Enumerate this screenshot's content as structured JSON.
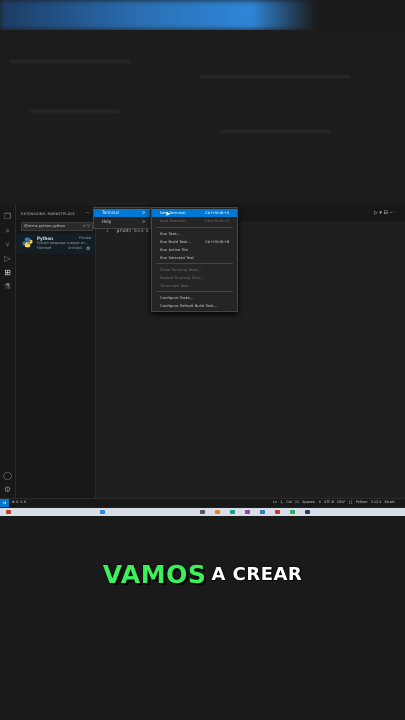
{
  "sidebar": {
    "title": "EXTENSIONS: MARKETPLACE",
    "search_value": "@id:ms-python.python",
    "extension": {
      "name": "Python",
      "description": "Python language support wi...",
      "publisher": "Microsoft",
      "badge": "Preview",
      "installs_label": "Uninstall"
    }
  },
  "editor": {
    "line_number": "1",
    "code_func": "print(",
    "code_str": "'hola m"
  },
  "menubar_menu": {
    "items": [
      {
        "label": "Terminal",
        "arrow": ">"
      },
      {
        "label": "Help",
        "arrow": ">"
      }
    ]
  },
  "terminal_menu": {
    "items": [
      {
        "label": "New Terminal",
        "shortcut": "Ctrl+Shift+ñ",
        "state": "highlighted"
      },
      {
        "label": "Split Terminal",
        "shortcut": "Ctrl+Shift+5",
        "state": "disabled"
      },
      {
        "label": "Run Task...",
        "shortcut": "",
        "state": "normal"
      },
      {
        "label": "Run Build Task...",
        "shortcut": "Ctrl+Shift+B",
        "state": "normal"
      },
      {
        "label": "Run Active File",
        "shortcut": "",
        "state": "normal"
      },
      {
        "label": "Run Selected Text",
        "shortcut": "",
        "state": "normal"
      },
      {
        "label": "Show Running Tasks...",
        "shortcut": "",
        "state": "disabled"
      },
      {
        "label": "Restart Running Task...",
        "shortcut": "",
        "state": "disabled"
      },
      {
        "label": "Terminate Task...",
        "shortcut": "",
        "state": "disabled"
      },
      {
        "label": "Configure Tasks...",
        "shortcut": "",
        "state": "normal"
      },
      {
        "label": "Configure Default Build Task...",
        "shortcut": "",
        "state": "normal"
      }
    ]
  },
  "status_bar": {
    "left": "⊗ 0 ⚠ 0",
    "right": "Ln 1, Col 21  Spaces: 4  UTF-8  CRLF  {} Python  3.12.4 64-bit"
  },
  "caption": {
    "highlight": "VAMOS",
    "rest": "A CREAR"
  },
  "colors": {
    "accent": "#0078d4",
    "caption_green": "#3cf05a"
  },
  "icons": [
    "explorer-icon",
    "search-icon",
    "source-control-icon",
    "run-debug-icon",
    "extensions-icon",
    "testing-icon",
    "account-icon",
    "settings-icon",
    "remote-icon",
    "python-logo-icon"
  ]
}
